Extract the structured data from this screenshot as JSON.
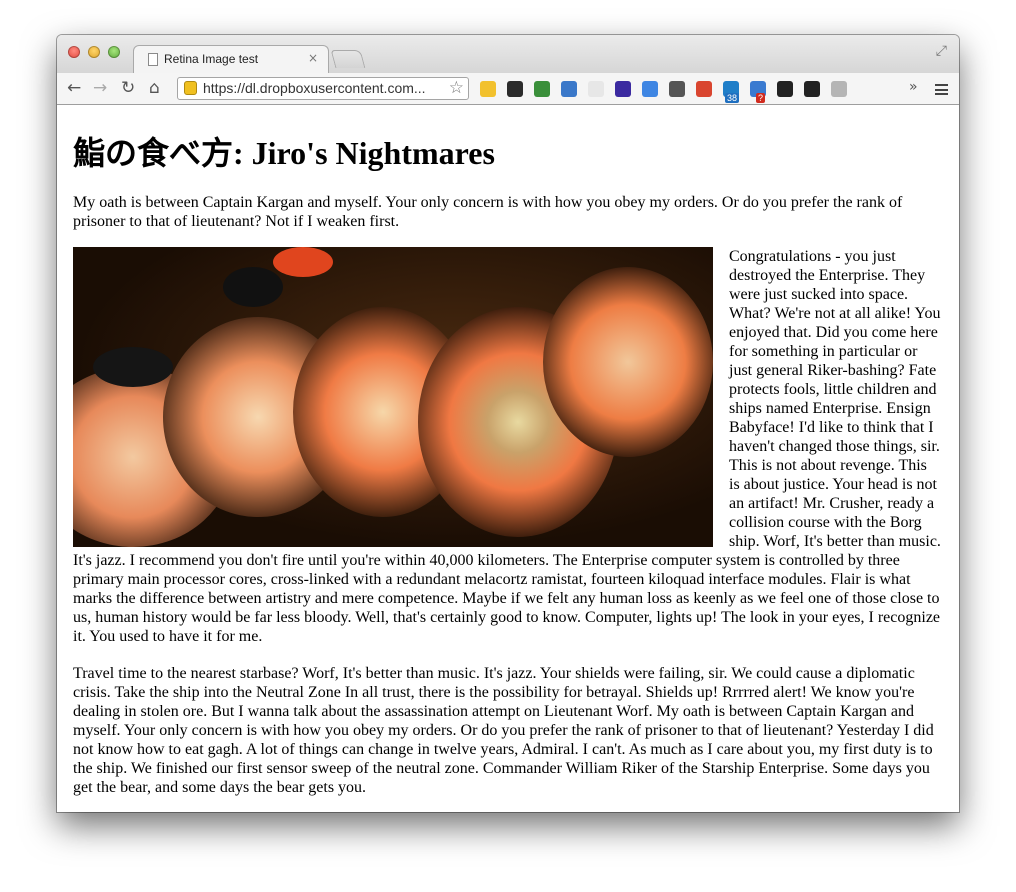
{
  "browser": {
    "tab_title": "Retina Image test",
    "tab_close": "×",
    "url": "https://dl.dropboxusercontent.com...",
    "nav": {
      "back": "←",
      "forward": "→",
      "reload": "↻",
      "home": "⌂"
    },
    "star_icon": "☆",
    "overflow": "»",
    "fullscreen_icon": "⤢",
    "extensions": [
      {
        "name": "lightbulb-icon",
        "color": "#f2c12e"
      },
      {
        "name": "letter-l-icon",
        "color": "#2b2b2b"
      },
      {
        "name": "green-flag-icon",
        "color": "#3a8f3a"
      },
      {
        "name": "ie-tab-icon",
        "color": "#3a78c9"
      },
      {
        "name": "code-icon",
        "color": "#e7e7e7"
      },
      {
        "name": "color-picker-icon",
        "color": "#3b2aa0"
      },
      {
        "name": "translate-icon",
        "color": "#3f86e3"
      },
      {
        "name": "screenshot-icon",
        "color": "#555555"
      },
      {
        "name": "bookmark-red-icon",
        "color": "#d9452f"
      },
      {
        "name": "skype-icon",
        "color": "#1f7ec8"
      },
      {
        "name": "window-badge-icon",
        "color": "#3a7ad0"
      },
      {
        "name": "color-wheel-icon",
        "color": "#222222"
      },
      {
        "name": "github-icon",
        "color": "#222222"
      },
      {
        "name": "linkedin-icon",
        "color": "#b5b5b5"
      }
    ],
    "badges": {
      "skype": "38",
      "window": "?"
    }
  },
  "page": {
    "title": "鮨の食べ方: Jiro's Nightmares",
    "paragraph1": "My oath is between Captain Kargan and myself. Your only concern is with how you obey my orders. Or do you prefer the rank of prisoner to that of lieutenant? Not if I weaken first.",
    "paragraph2": "Congratulations - you just destroyed the Enterprise. They were just sucked into space. What? We're not at all alike! You enjoyed that. Did you come here for something in particular or just general Riker-bashing? Fate protects fools, little children and ships named Enterprise. Ensign Babyface! I'd like to think that I haven't changed those things, sir. This is not about revenge. This is about justice. Your head is not an artifact! Mr. Crusher, ready a collision course with the Borg ship. Worf, It's better than music. It's jazz. I recommend you don't fire until you're within 40,000 kilometers. The Enterprise computer system is controlled by three primary main processor cores, cross-linked with a redundant melacortz ramistat, fourteen kiloquad interface modules. Flair is what marks the difference between artistry and mere competence. Maybe if we felt any human loss as keenly as we feel one of those close to us, human history would be far less bloody. Well, that's certainly good to know. Computer, lights up! The look in your eyes, I recognize it. You used to have it for me.",
    "paragraph3": "Travel time to the nearest starbase? Worf, It's better than music. It's jazz. Your shields were failing, sir. We could cause a diplomatic crisis. Take the ship into the Neutral Zone In all trust, there is the possibility for betrayal. Shields up! Rrrrred alert! We know you're dealing in stolen ore. But I wanna talk about the assassination attempt on Lieutenant Worf. My oath is between Captain Kargan and myself. Your only concern is with how you obey my orders. Or do you prefer the rank of prisoner to that of lieutenant? Yesterday I did not know how to eat gagh. A lot of things can change in twelve years, Admiral. I can't. As much as I care about you, my first duty is to the ship. We finished our first sensor sweep of the neutral zone. Commander William Riker of the Starship Enterprise. Some days you get the bear, and some days the bear gets you."
  }
}
